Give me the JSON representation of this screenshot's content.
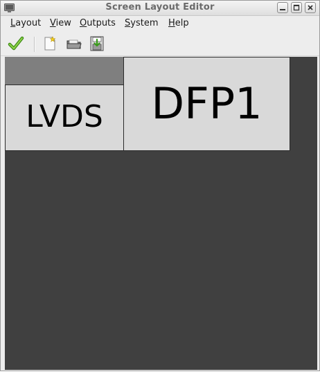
{
  "window": {
    "title": "Screen Layout Editor"
  },
  "menubar": {
    "items": [
      {
        "mnemonic": "L",
        "rest": "ayout"
      },
      {
        "mnemonic": "V",
        "rest": "iew"
      },
      {
        "mnemonic": "O",
        "rest": "utputs"
      },
      {
        "mnemonic": "S",
        "rest": "ystem"
      },
      {
        "mnemonic": "H",
        "rest": "elp"
      }
    ]
  },
  "toolbar": {
    "tools": [
      "apply-icon",
      "new-layout-icon",
      "open-layout-icon",
      "save-layout-icon"
    ]
  },
  "canvas": {
    "background": "#404040",
    "screens": [
      {
        "label": "LVDS"
      },
      {
        "label": "DFP1"
      }
    ]
  }
}
